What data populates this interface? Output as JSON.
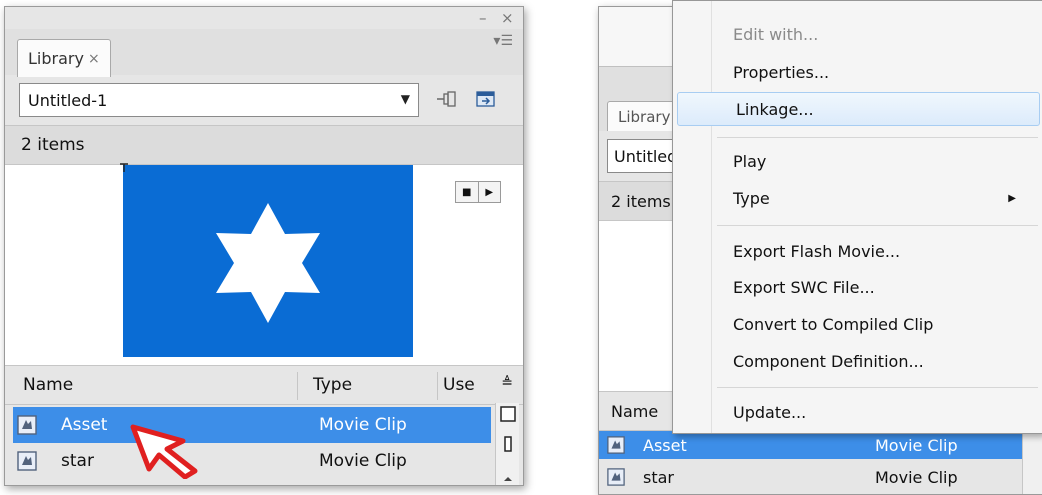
{
  "left_panel": {
    "window_controls": {
      "minimize": "–",
      "close": "×"
    },
    "tab": {
      "label": "Library",
      "close": "×"
    },
    "panel_menu_icon": "panel-menu-icon",
    "document_select": {
      "value": "Untitled-1"
    },
    "item_count": "2 items",
    "preview": {
      "background": "#0a6cd4",
      "shape": "six-point-star"
    },
    "columns": {
      "name": "Name",
      "type": "Type",
      "use": "Use"
    },
    "rows": [
      {
        "name": "Asset",
        "type": "Movie Clip",
        "selected": true
      },
      {
        "name": "star",
        "type": "Movie Clip",
        "selected": false
      }
    ]
  },
  "right_panel": {
    "tab_label": "Library",
    "document_select": "Untitled",
    "item_count": "2 items",
    "column_name": "Name",
    "rows": [
      {
        "name": "Asset",
        "type": "Movie Clip",
        "selected": true
      },
      {
        "name": "star",
        "type": "Movie Clip",
        "selected": false
      }
    ]
  },
  "context_menu": {
    "items": [
      {
        "label": "Edit with...",
        "disabled": true
      },
      {
        "label": "Properties..."
      },
      {
        "label": "Linkage...",
        "highlight": true
      },
      {
        "label": "Play"
      },
      {
        "label": "Type",
        "submenu": true
      },
      {
        "label": "Export Flash Movie..."
      },
      {
        "label": "Export SWC File..."
      },
      {
        "label": "Convert to Compiled Clip"
      },
      {
        "label": "Component Definition..."
      },
      {
        "label": "Update..."
      }
    ]
  },
  "colors": {
    "selection": "#3d8ee8",
    "panel_bg": "#e6e6e6",
    "preview_blue": "#0a6cd4",
    "cursor_red": "#e02020"
  }
}
